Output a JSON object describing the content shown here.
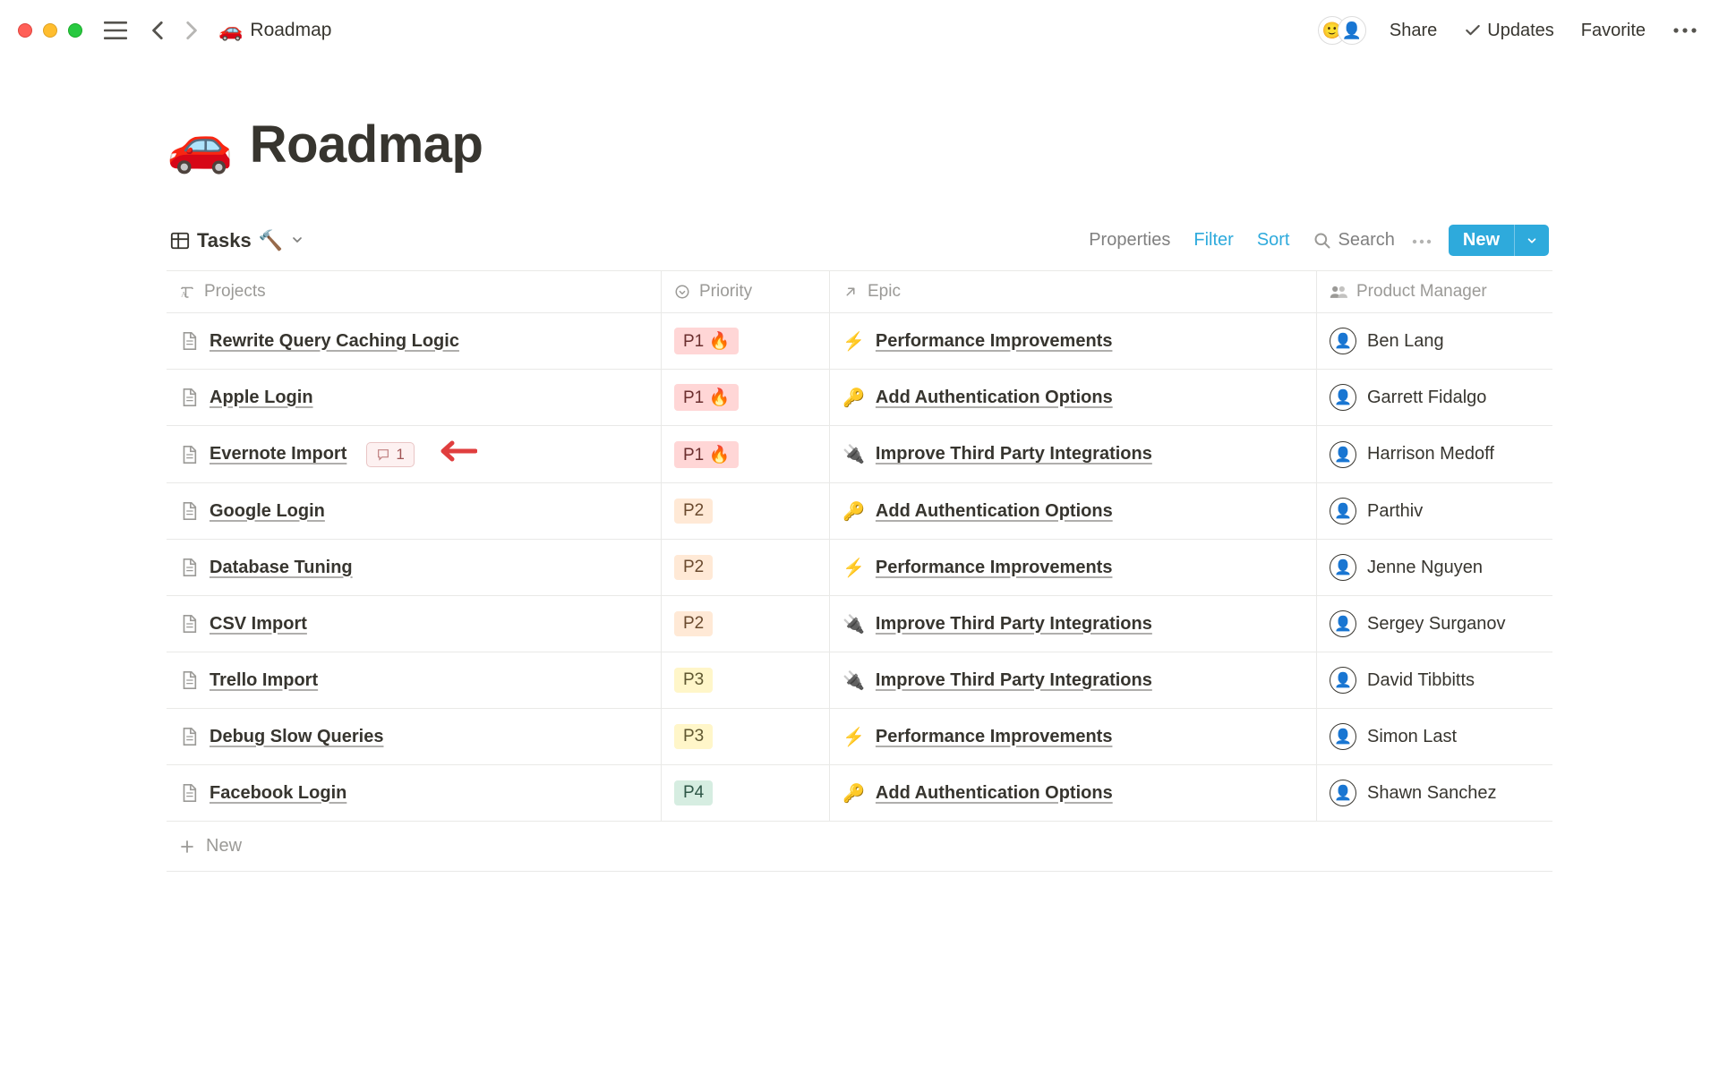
{
  "breadcrumb": {
    "icon": "🚗",
    "title": "Roadmap"
  },
  "topbar": {
    "share": "Share",
    "updates": "Updates",
    "favorite": "Favorite"
  },
  "page": {
    "icon": "🚗",
    "title": "Roadmap"
  },
  "view": {
    "name": "Tasks",
    "decor": "🔨"
  },
  "toolbar": {
    "properties": "Properties",
    "filter": "Filter",
    "sort": "Sort",
    "search": "Search",
    "new": "New"
  },
  "columns": {
    "projects": "Projects",
    "priority": "Priority",
    "epic": "Epic",
    "pm": "Product Manager"
  },
  "priority_emoji": {
    "P1": "🔥",
    "P2": "",
    "P3": "",
    "P4": ""
  },
  "rows": [
    {
      "project": "Rewrite Query Caching Logic",
      "priority": "P1",
      "epic_icon": "⚡",
      "epic": "Performance Improvements",
      "pm": "Ben Lang",
      "comments": null
    },
    {
      "project": "Apple Login",
      "priority": "P1",
      "epic_icon": "🔑",
      "epic": "Add Authentication Options",
      "pm": "Garrett Fidalgo",
      "comments": null
    },
    {
      "project": "Evernote Import",
      "priority": "P1",
      "epic_icon": "🔌",
      "epic": "Improve Third Party Integrations",
      "pm": "Harrison Medoff",
      "comments": 1,
      "highlight": true
    },
    {
      "project": "Google Login",
      "priority": "P2",
      "epic_icon": "🔑",
      "epic": "Add Authentication Options",
      "pm": "Parthiv",
      "comments": null
    },
    {
      "project": "Database Tuning",
      "priority": "P2",
      "epic_icon": "⚡",
      "epic": "Performance Improvements",
      "pm": "Jenne Nguyen",
      "comments": null
    },
    {
      "project": "CSV Import",
      "priority": "P2",
      "epic_icon": "🔌",
      "epic": "Improve Third Party Integrations",
      "pm": "Sergey Surganov",
      "comments": null
    },
    {
      "project": "Trello Import",
      "priority": "P3",
      "epic_icon": "🔌",
      "epic": "Improve Third Party Integrations",
      "pm": "David Tibbitts",
      "comments": null
    },
    {
      "project": "Debug Slow Queries",
      "priority": "P3",
      "epic_icon": "⚡",
      "epic": "Performance Improvements",
      "pm": "Simon Last",
      "comments": null
    },
    {
      "project": "Facebook Login",
      "priority": "P4",
      "epic_icon": "🔑",
      "epic": "Add Authentication Options",
      "pm": "Shawn Sanchez",
      "comments": null
    }
  ],
  "add_row": "New"
}
